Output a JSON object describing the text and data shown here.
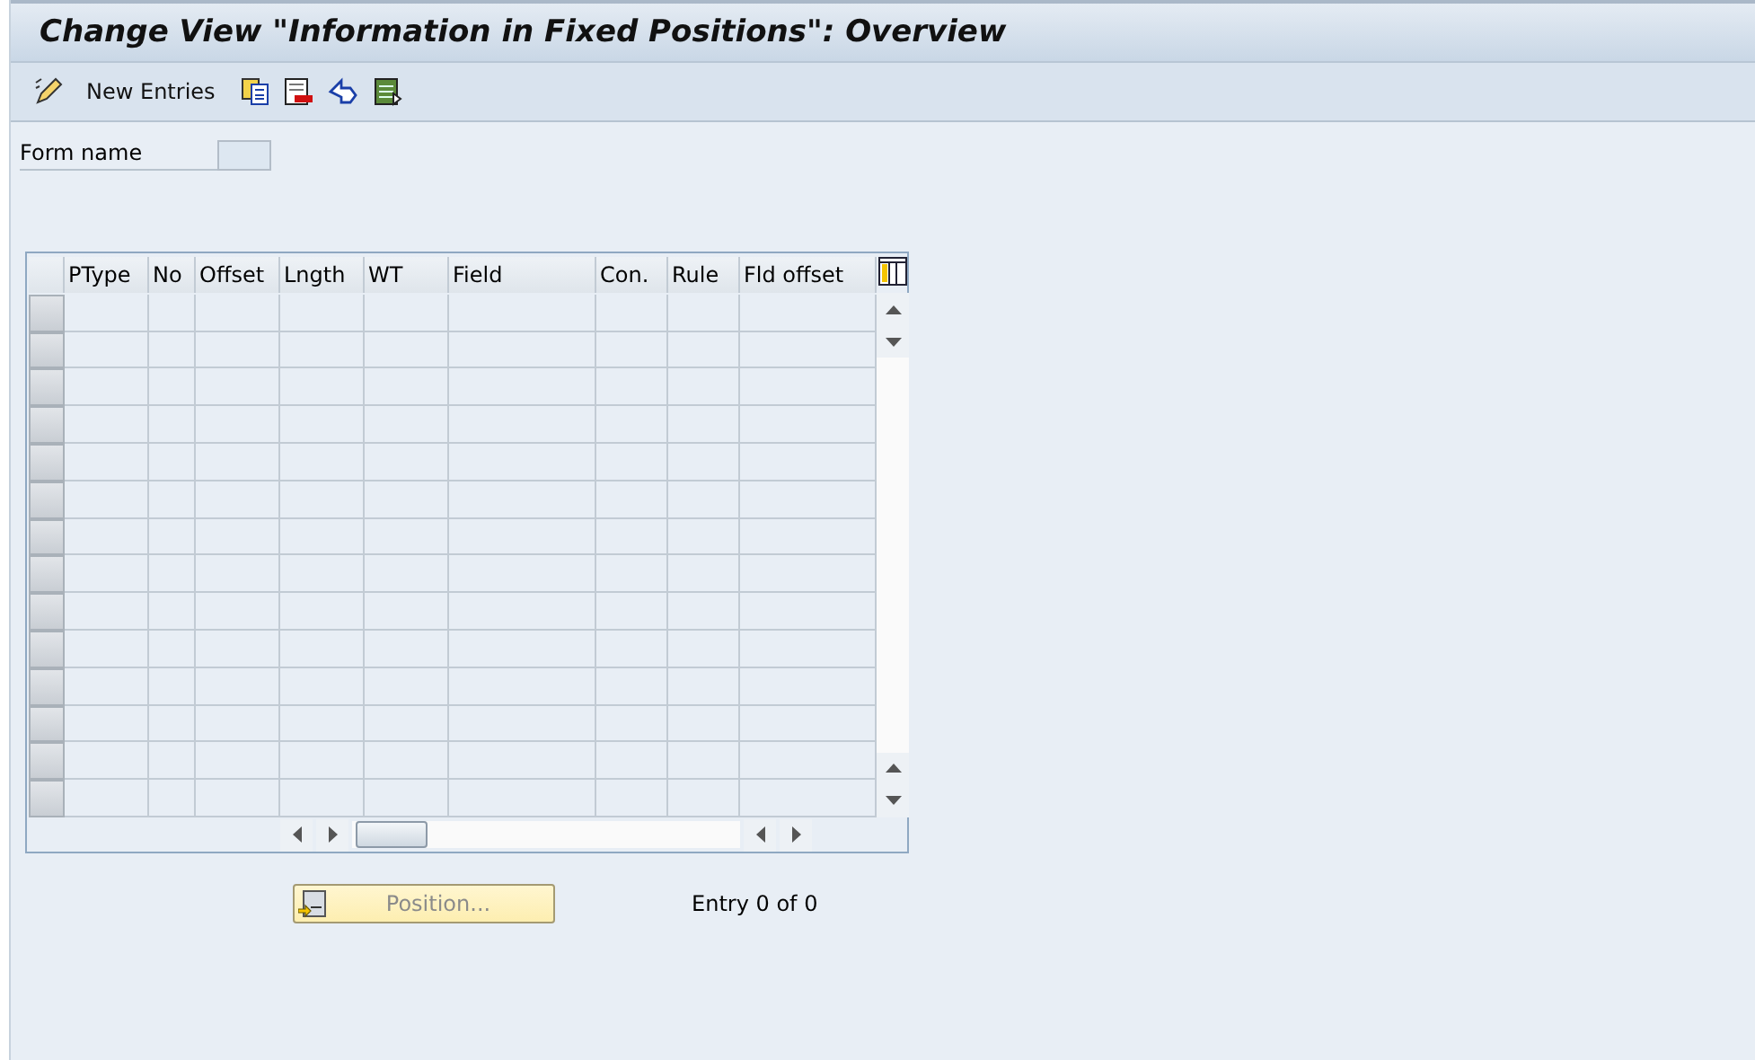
{
  "window": {
    "title": "Change View \"Information in Fixed Positions\": Overview"
  },
  "toolbar": {
    "new_entries": "New Entries"
  },
  "form": {
    "label": "Form name"
  },
  "table": {
    "columns": [
      "PType",
      "No",
      "Offset",
      "Lngth",
      "WT",
      "Field",
      "Con.",
      "Rule",
      "Fld offset"
    ]
  },
  "position_button": {
    "label": "Position...",
    "disabled": true
  },
  "entry_info": "Entry 0 of 0"
}
